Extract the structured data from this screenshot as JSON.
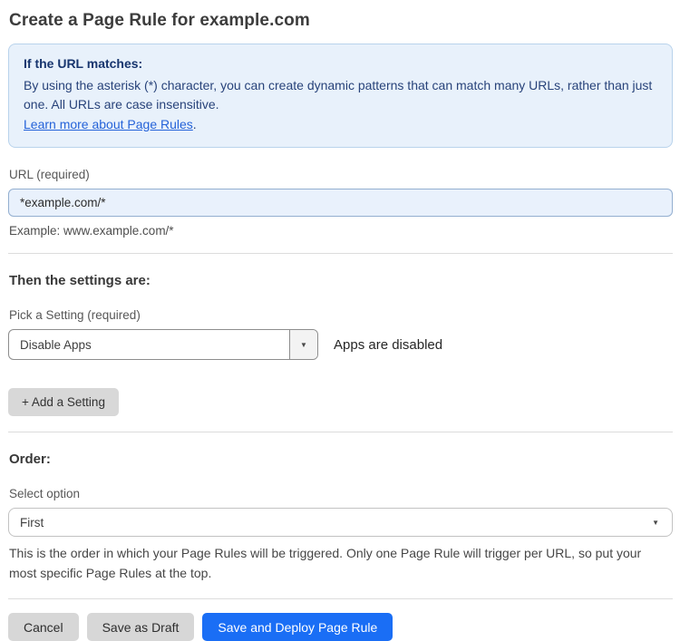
{
  "page": {
    "title": "Create a Page Rule for example.com"
  },
  "colors": {
    "info_box_bg": "#e8f1fb",
    "info_box_border": "#b9d3ec",
    "info_text_navy": "#28437a",
    "link_blue": "#2563d9",
    "url_input_bg": "#e9f1fc",
    "url_input_border": "#93afd0",
    "gray_button_bg": "#d7d7d7",
    "primary_button_bg": "#1a6ef5"
  },
  "icons": {
    "caret_down": "▼"
  },
  "info_box": {
    "heading": "If the URL matches:",
    "body": "By using the asterisk (*) character, you can create dynamic patterns that can match many URLs, rather than just one. All URLs are case insensitive.",
    "link_label": "Learn more about Page Rules",
    "link_suffix": "."
  },
  "url_field": {
    "label": "URL (required)",
    "value": "*example.com/*",
    "helper": "Example: www.example.com/*"
  },
  "settings": {
    "heading": "Then the settings are:",
    "picker_label": "Pick a Setting (required)",
    "selected_setting": "Disable Apps",
    "status_text": "Apps are disabled",
    "add_button_label": "+ Add a Setting"
  },
  "order": {
    "heading": "Order:",
    "select_label": "Select option",
    "selected_option": "First",
    "helper": "This is the order in which your Page Rules will be triggered. Only one Page Rule will trigger per URL, so put your most specific Page Rules at the top."
  },
  "actions": {
    "cancel_label": "Cancel",
    "save_draft_label": "Save as Draft",
    "save_deploy_label": "Save and Deploy Page Rule"
  }
}
